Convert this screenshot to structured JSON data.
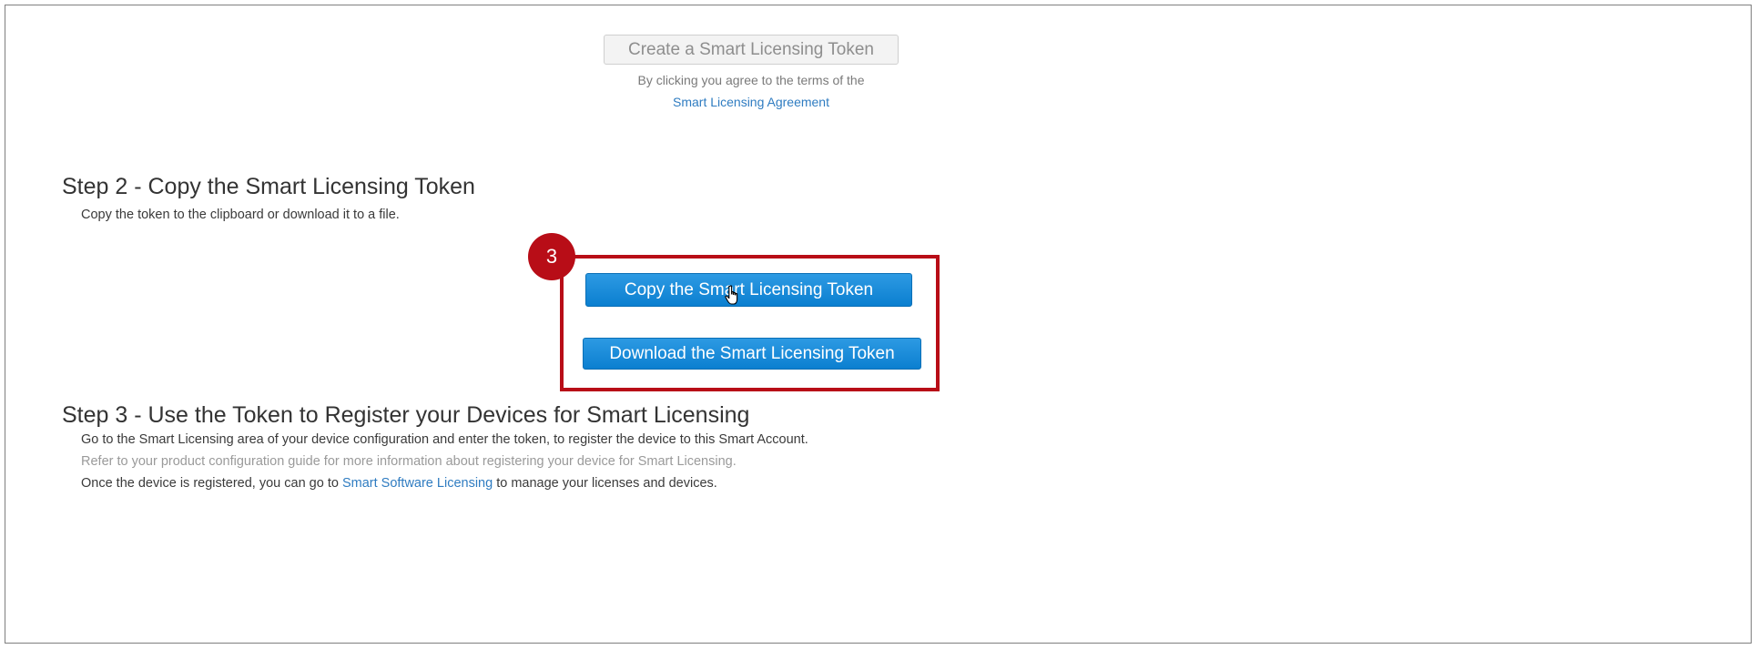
{
  "step1": {
    "create_button_label": "Create a Smart Licensing Token",
    "agree_text": "By clicking you agree to the terms of the",
    "agree_link": "Smart Licensing Agreement"
  },
  "step2": {
    "heading": "Step 2 - Copy the Smart Licensing Token",
    "description": "Copy the token to the clipboard or download it to a file.",
    "badge_number": "3",
    "copy_button_label": "Copy the Smart Licensing Token",
    "download_button_label": "Download the Smart Licensing Token"
  },
  "step3": {
    "heading": "Step 3 - Use the Token to Register your Devices for Smart Licensing",
    "line1": "Go to the Smart Licensing area of your device configuration and enter the token, to register the device to this Smart Account.",
    "line2": "Refer to your product configuration guide for more information about registering your device for Smart Licensing.",
    "line3_prefix": "Once the device is registered, you can go to ",
    "line3_link": "Smart Software Licensing",
    "line3_suffix": " to manage your licenses and devices."
  },
  "colors": {
    "accent_blue": "#0b7fd0",
    "highlight_red": "#b80d17",
    "link_blue": "#2f7cc1"
  },
  "icons": {
    "cursor": "hand-pointer-icon"
  }
}
